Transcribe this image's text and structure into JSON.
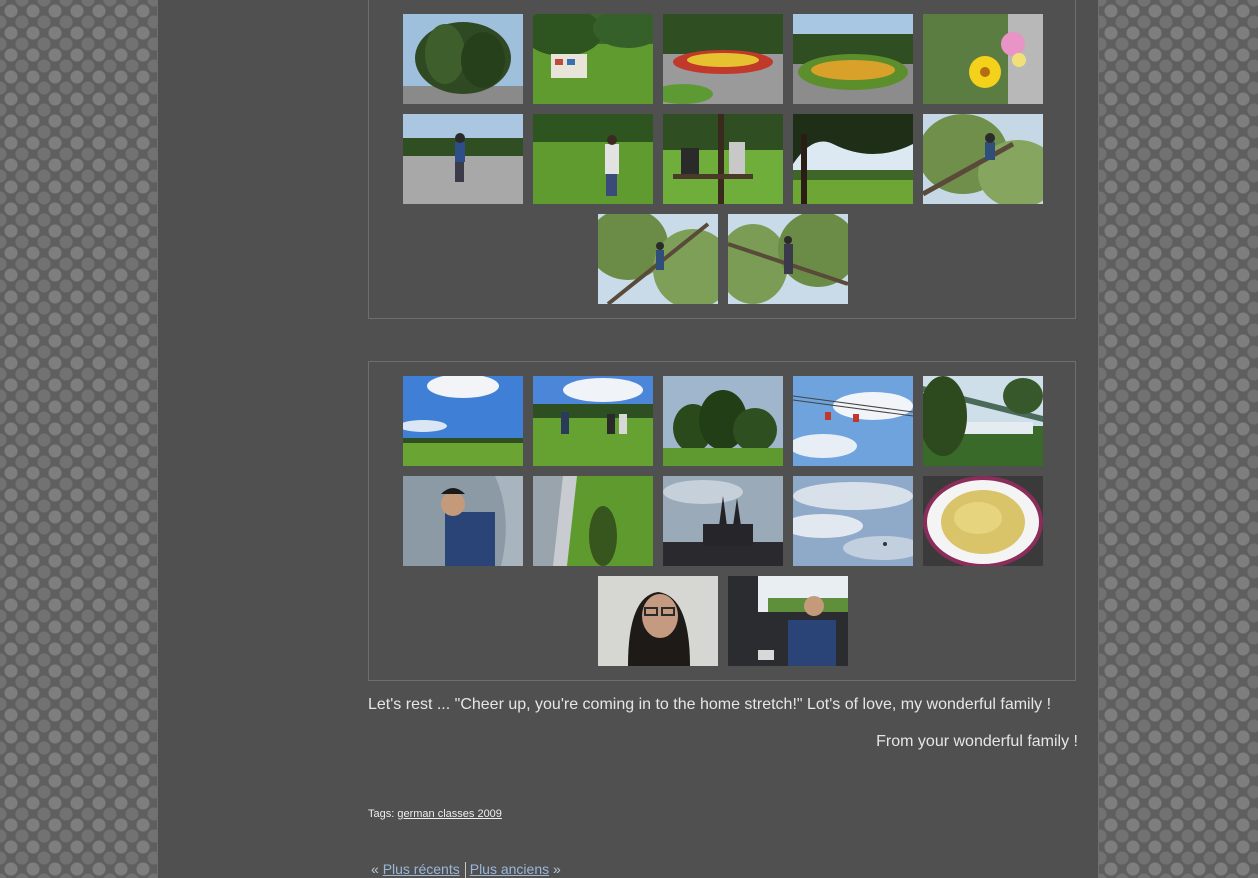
{
  "galleries": [
    {
      "photos": [
        "weeping-willow-tree",
        "park-miniature-train",
        "park-flowerbed-path",
        "round-flowerbed",
        "yellow-pink-flowers",
        "person-walking-pavement",
        "person-walking-lawn",
        "people-sitting-bench",
        "lawn-under-tree-shade",
        "boy-in-tree",
        "boy-climbing-tree",
        "boy-in-tree-branches"
      ]
    },
    {
      "photos": [
        "green-field-sky",
        "people-walking-field",
        "trees-on-field",
        "cable-car-sky",
        "bridge-over-river",
        "boy-sitting-pavement",
        "shadow-on-grass",
        "cathedral-silhouette",
        "cloudy-sky",
        "bowl-of-couscous",
        "girl-portrait-glasses",
        "boy-in-car"
      ]
    }
  ],
  "caption": "Let's rest ... \"Cheer up, you're coming in to the home stretch!\" Lot's of love, my wonderful family !",
  "signature": "From your wonderful family !",
  "tags": {
    "label": "Tags:",
    "link": "german classes 2009"
  },
  "pager": {
    "prev_arrow": "«",
    "newer": "Plus récents",
    "older": "Plus anciens",
    "next_arrow": "»"
  }
}
